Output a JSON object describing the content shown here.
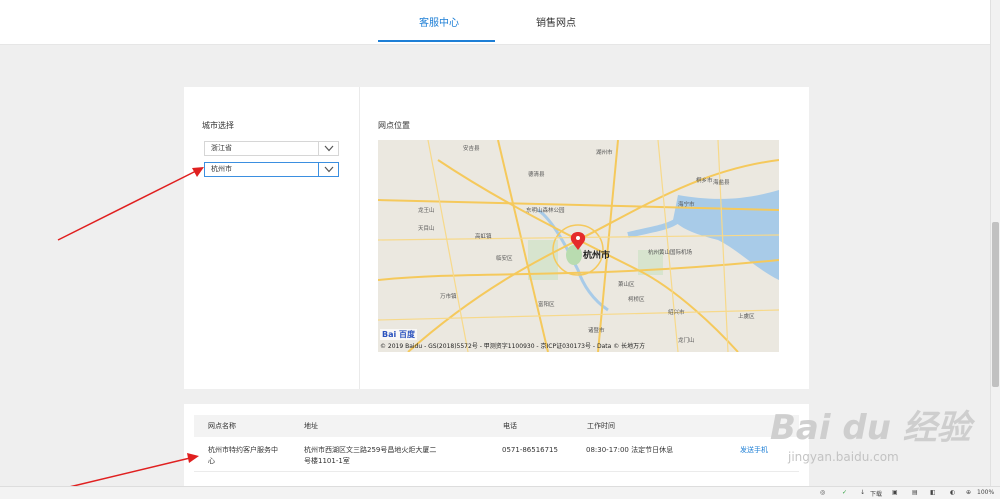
{
  "tabs": [
    {
      "label": "客服中心",
      "active": true
    },
    {
      "label": "销售网点",
      "active": false
    }
  ],
  "city_select": {
    "label": "城市选择",
    "province_value": "浙江省",
    "city_value": "杭州市"
  },
  "map": {
    "label": "网点位置",
    "city_name": "杭州市",
    "logo_text": "Bai 百度",
    "copyright": "© 2019 Baidu - GS(2018)5572号 - 甲测资字1100930 - 京ICP证030173号 - Data © 长地万方",
    "places": [
      "安吉县",
      "湖州市",
      "桐乡市",
      "海宁市",
      "德清县",
      "龙王山",
      "天目山",
      "东明山森林公园",
      "杭州黄山国际机场",
      "临安区",
      "萧山区",
      "柯桥区",
      "绍兴市",
      "富阳区",
      "高虹镇",
      "万市镇",
      "海盐县",
      "上虞区",
      "诸暨市",
      "龙门山"
    ]
  },
  "table": {
    "headers": {
      "name": "网点名称",
      "address": "地址",
      "phone": "电话",
      "hours": "工作时间"
    },
    "rows": [
      {
        "name_line1": "杭州市特约客户服务中",
        "name_line2": "心",
        "address_line1": "杭州市西湖区文三路259号昌地火炬大厦二",
        "address_line2": "号楼1101-1室",
        "phone": "0571-86516715",
        "hours": "08:30-17:00 法定节日休息",
        "action": "发送手机"
      }
    ]
  },
  "statusbar": {
    "download": "下载",
    "zoom": "100%"
  },
  "watermark": {
    "text": "Bai du 经验",
    "sub": "jingyan.baidu.com"
  },
  "colors": {
    "accent": "#1e7fd6",
    "arrow": "#e02020",
    "marker": "#e52b2b"
  }
}
